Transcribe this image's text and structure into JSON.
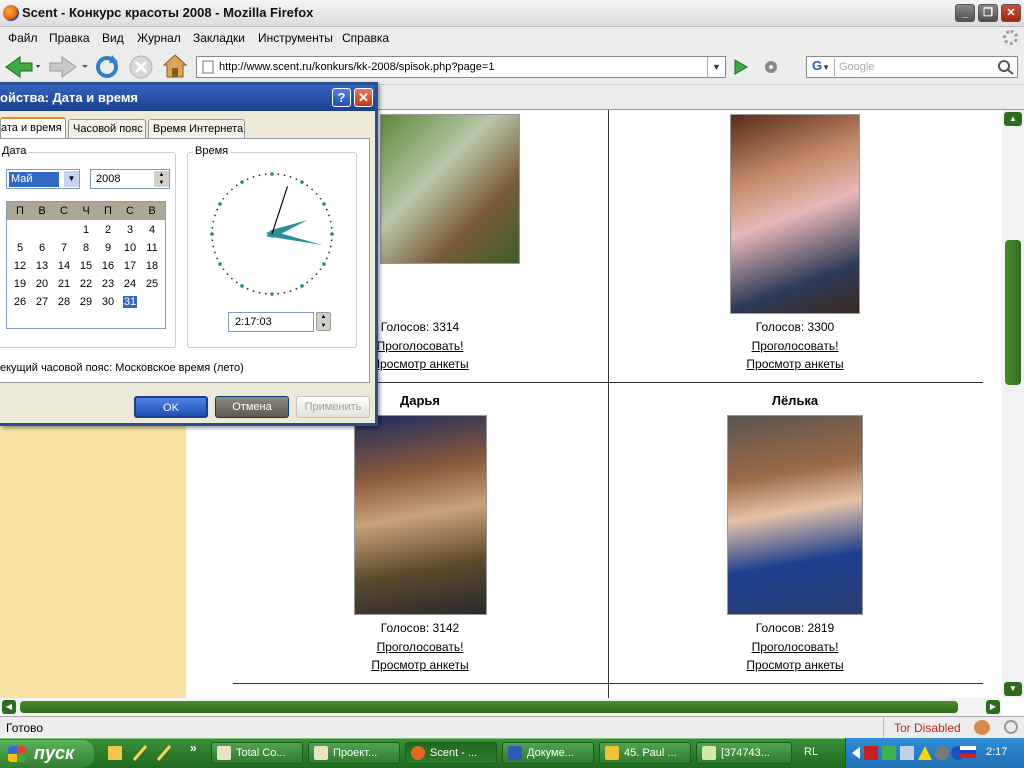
{
  "window": {
    "title": "Scent - Конкурс красоты 2008 - Mozilla Firefox"
  },
  "menu": [
    "Файл",
    "Правка",
    "Вид",
    "Журнал",
    "Закладки",
    "Инструменты",
    "Справка"
  ],
  "address": {
    "url": "http://www.scent.ru/konkurs/kk-2008/spisok.php?page=1"
  },
  "search": {
    "placeholder": "Google"
  },
  "contestants": [
    {
      "name": "",
      "votes": "Голосов: 3314",
      "vote_link": "Проголосовать!",
      "profile_link": "Просмотр анкеты"
    },
    {
      "name": "",
      "votes": "Голосов: 3300",
      "vote_link": "Проголосовать!",
      "profile_link": "Просмотр анкеты"
    },
    {
      "name": "Дарья",
      "votes": "Голосов: 3142",
      "vote_link": "Проголосовать!",
      "profile_link": "Просмотр анкеты"
    },
    {
      "name": "Лёлька",
      "votes": "Голосов: 2819",
      "vote_link": "Проголосовать!",
      "profile_link": "Просмотр анкеты"
    }
  ],
  "dialog": {
    "title": "ойства: Дата и время",
    "tabs": [
      "ата и время",
      "Часовой пояс",
      "Время Интернета"
    ],
    "date_group": "Дата",
    "time_group": "Время",
    "month": "Май",
    "year": "2008",
    "weekdays": [
      "П",
      "В",
      "С",
      "Ч",
      "П",
      "С",
      "В"
    ],
    "weeks": [
      [
        "",
        "",
        "",
        "1",
        "2",
        "3",
        "4"
      ],
      [
        "5",
        "6",
        "7",
        "8",
        "9",
        "10",
        "11"
      ],
      [
        "12",
        "13",
        "14",
        "15",
        "16",
        "17",
        "18"
      ],
      [
        "19",
        "20",
        "21",
        "22",
        "23",
        "24",
        "25"
      ],
      [
        "26",
        "27",
        "28",
        "29",
        "30",
        "31",
        ""
      ]
    ],
    "selected_day": "31",
    "time": "2:17:03",
    "clock": {
      "hours": 2,
      "minutes": 17,
      "seconds": 3
    },
    "timezone": "екущий часовой пояс: Московское время (лето)",
    "ok": "OK",
    "cancel": "Отмена",
    "apply": "Применить"
  },
  "status": {
    "text": "Готово",
    "tor": "Tor Disabled"
  },
  "taskbar": {
    "start": "пуск",
    "items": [
      "Total Co...",
      "Проект...",
      "Scent - ...",
      "Докуме...",
      "45. Paul ...",
      "[374743..."
    ],
    "lang": "RL",
    "clock": "2:17"
  }
}
